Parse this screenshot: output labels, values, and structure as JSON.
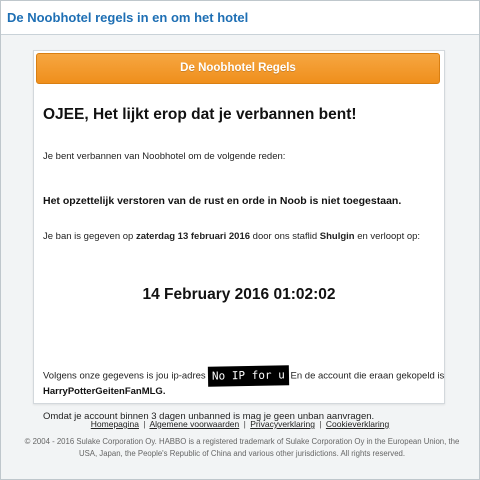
{
  "window": {
    "title": "De Noobhotel regels in en om het hotel"
  },
  "card": {
    "header": "De Noobhotel Regels",
    "heading": "OJEE, Het lijkt erop dat je verbannen bent!",
    "reason_intro": "Je bent verbannen van Noobhotel om de volgende reden:",
    "reason": "Het opzettelijk verstoren van de rust en orde in Noob is niet toegestaan.",
    "ban_info": {
      "prefix": "Je ban is gegeven op ",
      "date": "zaterdag 13 februari 2016",
      "middle": " door ons staflid ",
      "staff": "Shulgin",
      "suffix": " en verloopt op:"
    },
    "expiry": "14 February 2016 01:02:02",
    "ip_info": {
      "prefix": "Volgens onze gegevens is jou ip-adres",
      "redacted": "No IP for u",
      "suffix": "En de account die eraan gekopeld is"
    },
    "account": "HarryPotterGeitenFanMLG.",
    "unban_note": "Omdat je account binnen 3 dagen unbanned is mag je geen unban aanvragen."
  },
  "footer": {
    "links": [
      "Homepagina",
      "Algemene voorwaarden",
      "Privacyverklaring",
      "Cookieverklaring"
    ],
    "separator": "|",
    "copyright_line1": "© 2004 - 2016 Sulake Corporation Oy. HABBO is a registered trademark of Sulake Corporation Oy in the European Union, the",
    "copyright_line2": "USA, Japan, the People's Republic of China and various other jurisdictions. All rights reserved."
  },
  "colors": {
    "title": "#1e6fb4",
    "header_orange": "#ef8f1c",
    "background": "#f2f4f5"
  }
}
